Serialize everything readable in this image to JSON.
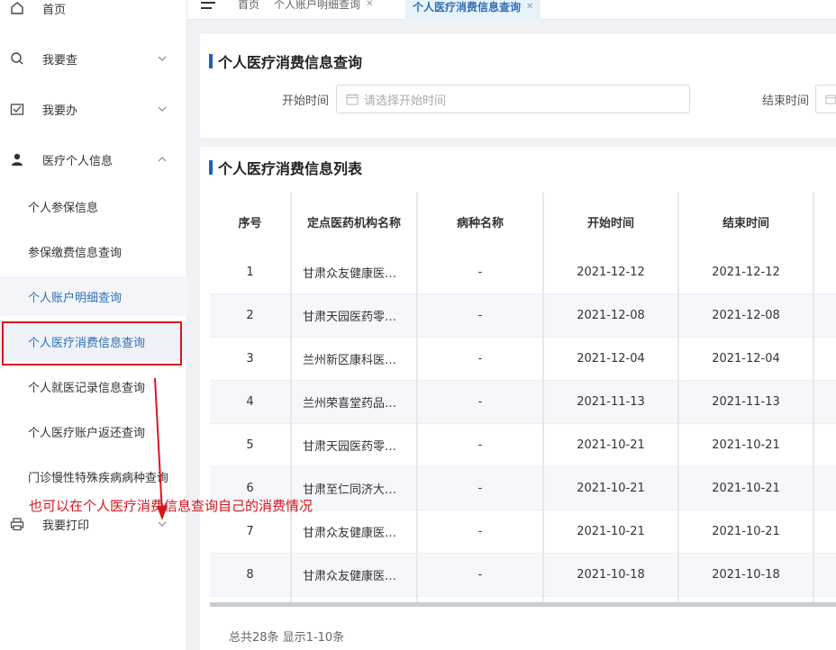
{
  "sidebar": {
    "menu": [
      {
        "label": "首页",
        "icon": "home-icon"
      },
      {
        "label": "我要查",
        "icon": "search-icon"
      },
      {
        "label": "我要办",
        "icon": "task-icon"
      },
      {
        "label": "医疗个人信息",
        "icon": "user-icon"
      },
      {
        "label": "我要打印",
        "icon": "printer-icon"
      }
    ],
    "sub_items": [
      "个人参保信息",
      "参保缴费信息查询",
      "个人账户明细查询",
      "个人医疗消费信息查询",
      "个人就医记录信息查询",
      "个人医疗账户返还查询",
      "门诊慢性特殊疾病病种查询"
    ]
  },
  "tabs": [
    {
      "label": "首页"
    },
    {
      "label": "个人账户明细查询"
    },
    {
      "label": "个人医疗消费信息查询"
    }
  ],
  "query_panel": {
    "title": "个人医疗消费信息查询",
    "start_label": "开始时间",
    "start_placeholder": "请选择开始时间",
    "end_label": "结束时间"
  },
  "list_panel": {
    "title": "个人医疗消费信息列表",
    "columns": [
      "序号",
      "定点医药机构名称",
      "病种名称",
      "开始时间",
      "结束时间"
    ],
    "rows": [
      [
        "1",
        "甘肃众友健康医…",
        "-",
        "2021-12-12",
        "2021-12-12"
      ],
      [
        "2",
        "甘肃天园医药零…",
        "-",
        "2021-12-08",
        "2021-12-08"
      ],
      [
        "3",
        "兰州新区康科医…",
        "-",
        "2021-12-04",
        "2021-12-04"
      ],
      [
        "4",
        "兰州荣喜堂药品…",
        "-",
        "2021-11-13",
        "2021-11-13"
      ],
      [
        "5",
        "甘肃天园医药零…",
        "-",
        "2021-10-21",
        "2021-10-21"
      ],
      [
        "6",
        "甘肃至仁同济大…",
        "-",
        "2021-10-21",
        "2021-10-21"
      ],
      [
        "7",
        "甘肃众友健康医…",
        "-",
        "2021-10-21",
        "2021-10-21"
      ],
      [
        "8",
        "甘肃众友健康医…",
        "-",
        "2021-10-18",
        "2021-10-18"
      ]
    ],
    "footer": "总共28条 显示1-10条"
  },
  "annotation": {
    "text": "也可以在个人医疗消费信息查询自己的消费情况",
    "color": "#d7171f"
  },
  "colors": {
    "accent": "#1e62b6",
    "active_tab_bg": "#e8f2fb"
  }
}
